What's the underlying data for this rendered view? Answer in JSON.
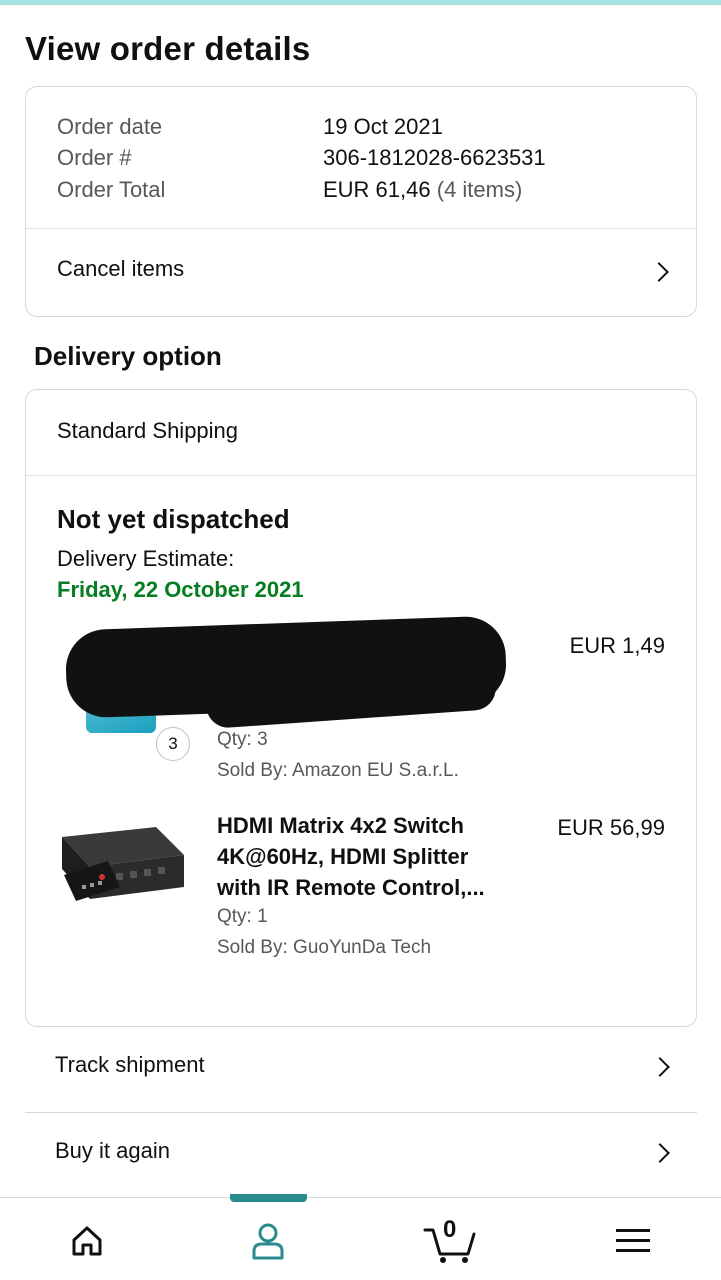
{
  "page": {
    "title": "View order details"
  },
  "order": {
    "date_label": "Order date",
    "date_value": "19 Oct 2021",
    "number_label": "Order #",
    "number_value": "306-1812028-6623531",
    "total_label": "Order Total",
    "total_value": "EUR 61,46",
    "total_items": "(4 items)"
  },
  "actions": {
    "cancel_items": "Cancel items",
    "track_shipment": "Track shipment",
    "buy_again": "Buy it again"
  },
  "delivery": {
    "section_title": "Delivery option",
    "method": "Standard Shipping",
    "status": "Not yet dispatched",
    "estimate_label": "Delivery Estimate:",
    "estimate_date": "Friday, 22 October 2021"
  },
  "items": [
    {
      "title": "",
      "price": "EUR 1,49",
      "qty": "Qty: 3",
      "qty_badge": "3",
      "seller": "Sold By: Amazon EU S.a.r.L.",
      "redacted": true
    },
    {
      "title": "HDMI Matrix 4x2 Switch 4K@60Hz, HDMI Splitter with IR Remote Control,...",
      "price": "EUR 56,99",
      "qty": "Qty: 1",
      "seller": "Sold By: GuoYunDa Tech"
    }
  ],
  "navbar": {
    "cart_count": "0",
    "active_tab": "account",
    "items": [
      "home-icon",
      "account-icon",
      "cart-icon",
      "menu-icon"
    ]
  },
  "colors": {
    "accent": "#2a8b8e",
    "delivery_date": "#067d20",
    "top_stripe": "#a7e3e3"
  }
}
